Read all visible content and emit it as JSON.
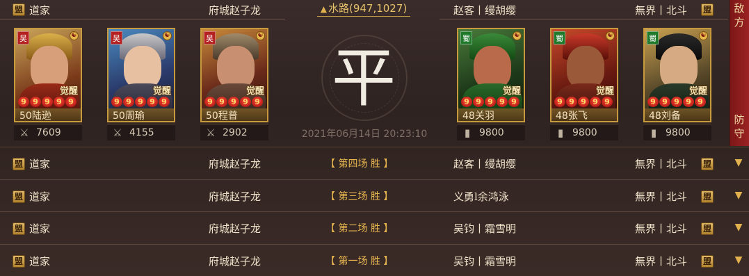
{
  "header": {
    "left_player_icon": "player-emblem-icon",
    "left_player_icon_glyph": "盟",
    "left_player_name": "道家",
    "left_server": "府城赵子龙",
    "location_label": "水路(947,1027)",
    "right_player": "赵客丨缦胡缨",
    "right_server": "無界丨北斗",
    "right_player_icon_glyph": "盟"
  },
  "side_panel": {
    "top_label": "敌方",
    "bottom_label": "防守"
  },
  "result_char": "平",
  "timestamp": "2021年06月14日  20:23:10",
  "left_team": [
    {
      "faction": "吴",
      "level_name": "50陆逊",
      "power": "7609",
      "stars": [
        "9",
        "9",
        "9",
        "9",
        "9"
      ],
      "awaken": "觉醒",
      "power_icon": "crossed-swords-icon"
    },
    {
      "faction": "吴",
      "level_name": "50周瑜",
      "power": "4155",
      "stars": [
        "9",
        "9",
        "9",
        "9",
        "9"
      ],
      "awaken": "觉醒",
      "power_icon": "crossed-swords-icon"
    },
    {
      "faction": "吴",
      "level_name": "50程普",
      "power": "2902",
      "stars": [
        "9",
        "9",
        "9",
        "9",
        "9"
      ],
      "awaken": "觉醒",
      "power_icon": "crossed-swords-icon"
    }
  ],
  "right_team": [
    {
      "faction": "蜀",
      "level_name": "48关羽",
      "power": "9800",
      "stars": [
        "9",
        "9",
        "9",
        "9",
        "9"
      ],
      "awaken": "觉醒",
      "power_icon": "troop-icon"
    },
    {
      "faction": "蜀",
      "level_name": "48张飞",
      "power": "9800",
      "stars": [
        "9",
        "9",
        "9",
        "9",
        "9"
      ],
      "awaken": "觉醒",
      "power_icon": "troop-icon"
    },
    {
      "faction": "蜀",
      "level_name": "48刘备",
      "power": "9800",
      "stars": [
        "9",
        "9",
        "9",
        "9",
        "9"
      ],
      "awaken": "觉醒",
      "power_icon": "troop-icon"
    }
  ],
  "battles": [
    {
      "left_name": "道家",
      "left_server": "府城赵子龙",
      "result": "第四场 胜",
      "right_player": "赵客丨缦胡缨",
      "right_server": "無界丨北斗"
    },
    {
      "left_name": "道家",
      "left_server": "府城赵子龙",
      "result": "第三场 胜",
      "right_player": "义勇l余鸿泳",
      "right_server": "無界丨北斗"
    },
    {
      "left_name": "道家",
      "left_server": "府城赵子龙",
      "result": "第二场 胜",
      "right_player": "吴钧丨霜雪明",
      "right_server": "無界丨北斗"
    },
    {
      "left_name": "道家",
      "left_server": "府城赵子龙",
      "result": "第一场 胜",
      "right_player": "吴钧丨霜雪明",
      "right_server": "無界丨北斗"
    }
  ],
  "colors": {
    "wu_faction": "#b52020",
    "shu_faction": "#1f7a2c",
    "accent_gold": "#e8b64f",
    "side_panel": "#8e1c1c"
  }
}
